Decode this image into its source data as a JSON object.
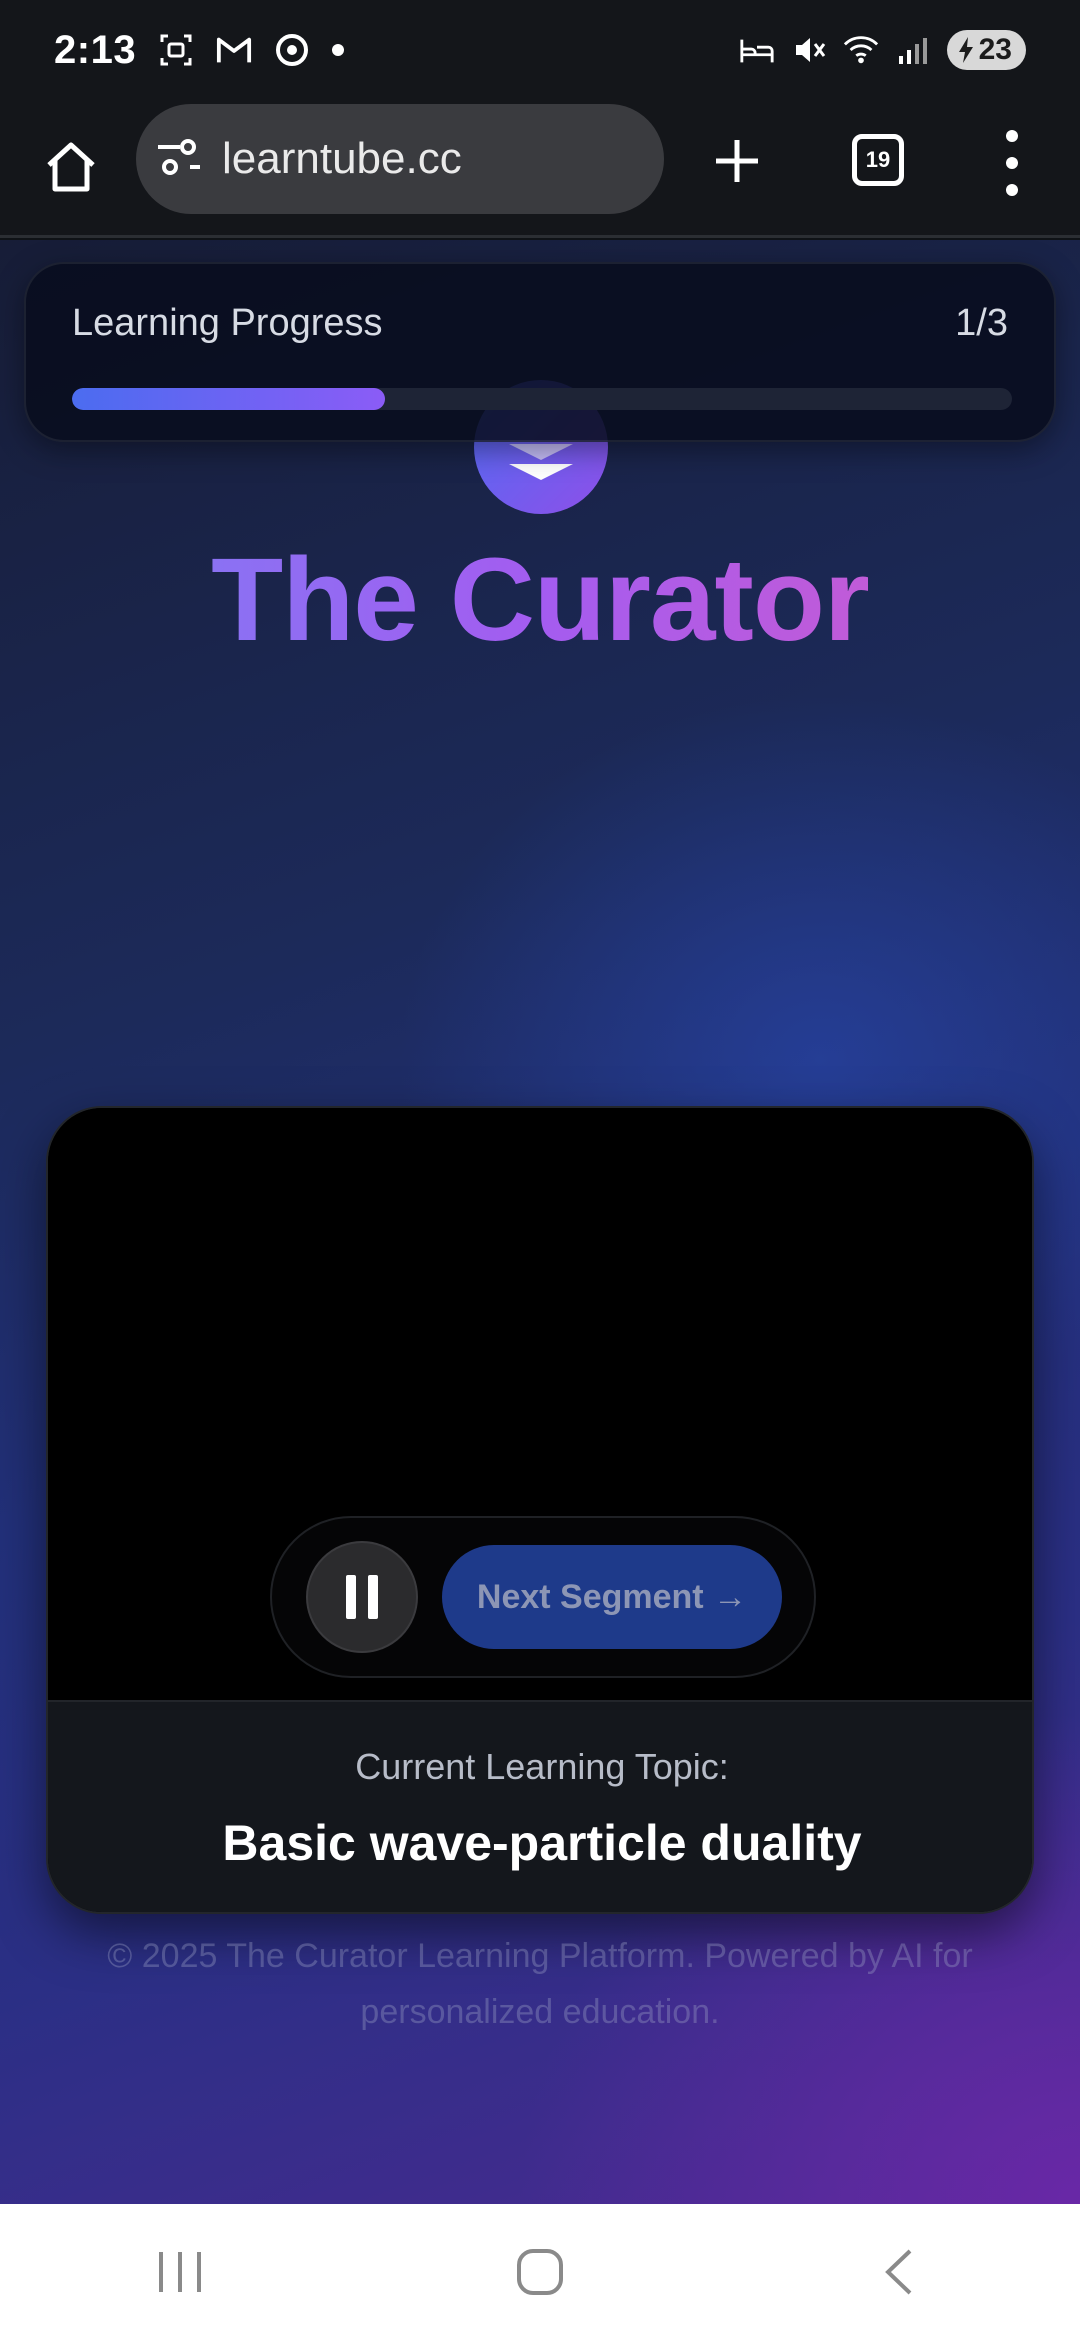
{
  "status_bar": {
    "time": "2:13",
    "battery": "23",
    "icons": [
      "screenshot-icon",
      "gmail-icon",
      "chrome-icon",
      "notification-dot-icon",
      "alarm-icon",
      "mute-icon",
      "wifi-icon",
      "signal-icon",
      "charging-icon"
    ]
  },
  "browser": {
    "url": "learntube.cc",
    "tab_count": "19",
    "icons": [
      "home-icon",
      "site-settings-icon",
      "new-tab-icon",
      "tabs-icon",
      "menu-icon"
    ]
  },
  "progress": {
    "label": "Learning Progress",
    "count": "1/3",
    "fraction": 0.333
  },
  "hero": {
    "title": "The Curator",
    "logo_icon": "chevrons-down-icon"
  },
  "player": {
    "next_label": "Next Segment →",
    "pause_icon": "pause-icon",
    "topic_label": "Current Learning Topic:",
    "topic_value": "Basic wave-particle duality"
  },
  "footer": {
    "text": "© 2025 The Curator Learning Platform. Powered by AI for personalized education."
  },
  "nav_bar": {
    "icons": [
      "recent-apps-icon",
      "home-button-icon",
      "back-icon"
    ]
  },
  "colors": {
    "accent_blue": "#4b6cf0",
    "accent_purple": "#8b5cf6",
    "title_pink": "#d45ac8",
    "next_button_bg": "#1e3a8a"
  }
}
